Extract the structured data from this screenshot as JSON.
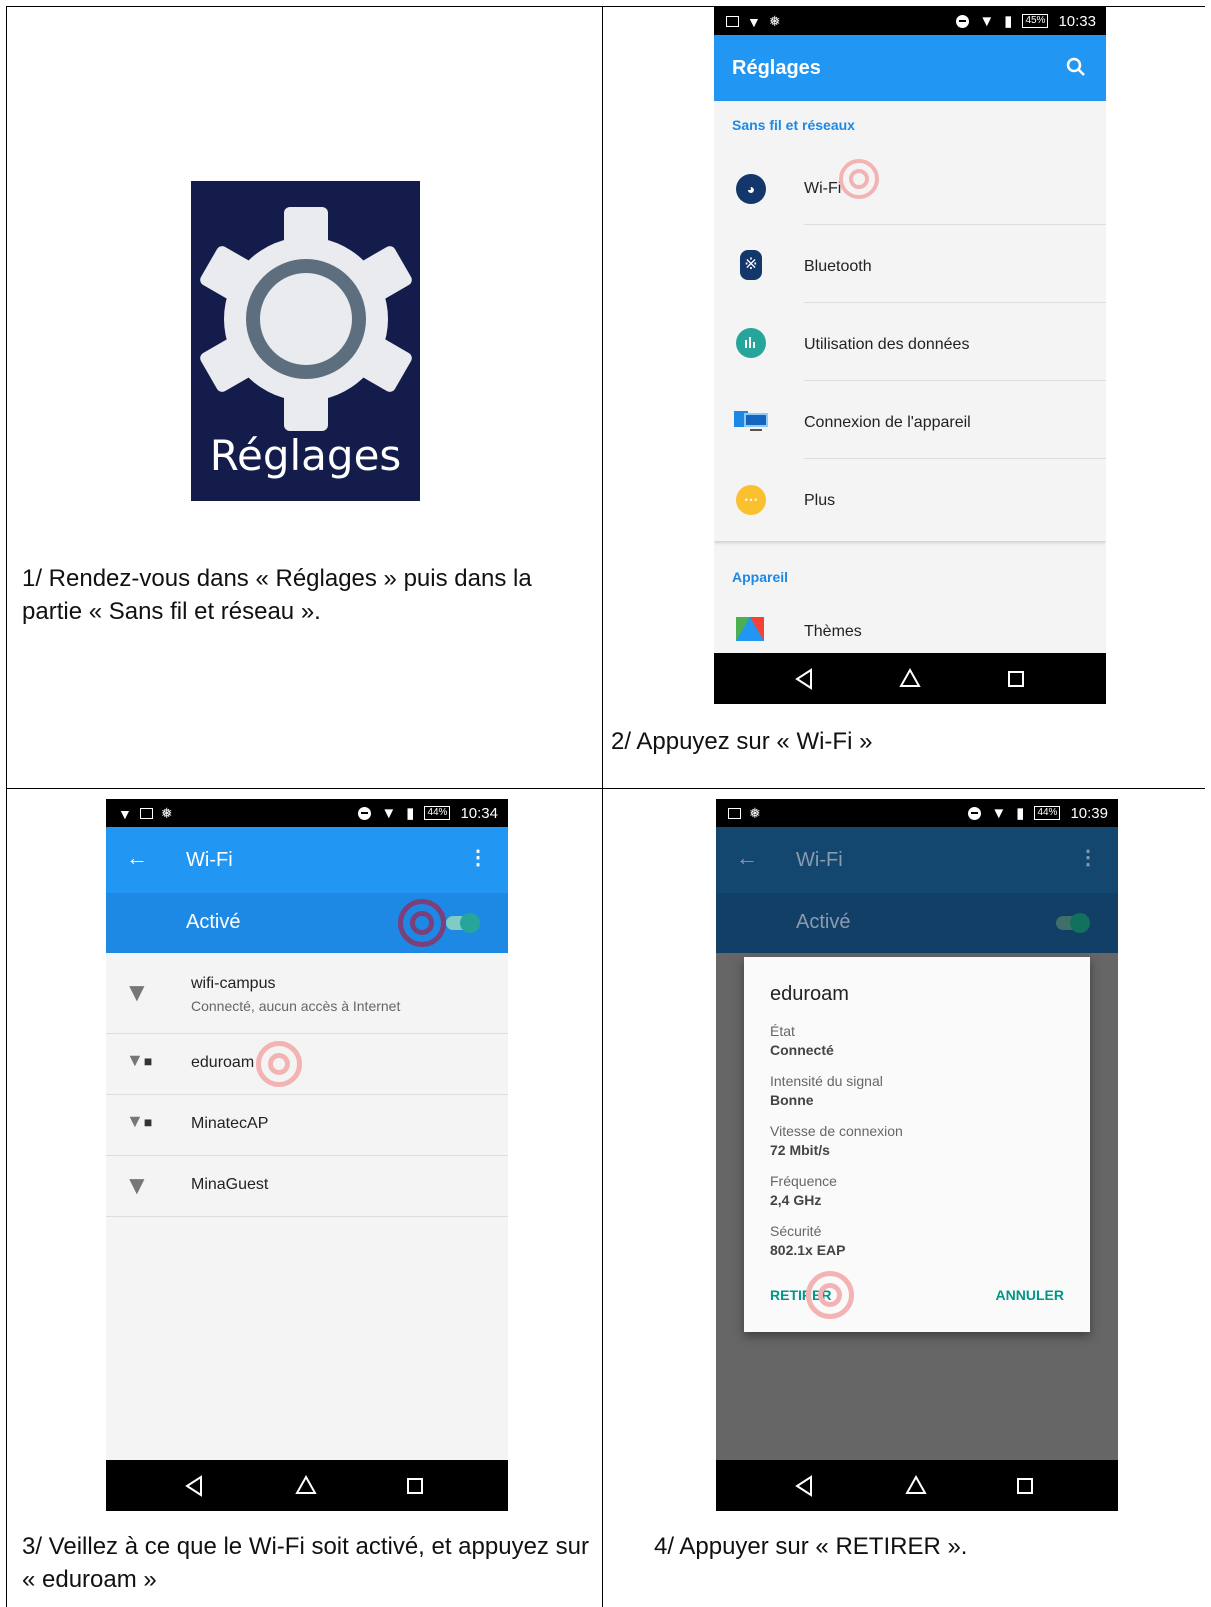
{
  "steps": {
    "step1": {
      "caption": "1/ Rendez-vous dans « Réglages » puis dans la partie « Sans fil et réseau »."
    },
    "step2": {
      "caption": "2/ Appuyez sur « Wi-Fi »"
    },
    "step3": {
      "caption": "3/ Veillez à ce que le Wi-Fi soit activé, et appuyez sur « eduroam »"
    },
    "step4": {
      "caption": "4/ Appuyer sur « RETIRER »."
    }
  },
  "app_icon": {
    "label": "Réglages",
    "icon": "gear-icon",
    "bg": "#141c4c"
  },
  "screen2": {
    "status": {
      "battery": "45%",
      "time": "10:33"
    },
    "title": "Réglages",
    "section1": "Sans fil et réseaux",
    "items": [
      {
        "label": "Wi-Fi",
        "icon": "wifi-icon",
        "color": "#13366b"
      },
      {
        "label": "Bluetooth",
        "icon": "bluetooth-icon",
        "color": "#13366b"
      },
      {
        "label": "Utilisation des données",
        "icon": "data-usage-icon",
        "color": "#26a69a"
      },
      {
        "label": "Connexion de l'appareil",
        "icon": "device-connection-icon",
        "color": "#1e88e5"
      },
      {
        "label": "Plus",
        "icon": "more-icon",
        "color": "#fbc02d"
      }
    ],
    "section2": "Appareil",
    "item_themes": "Thèmes"
  },
  "screen3": {
    "status": {
      "battery": "44%",
      "time": "10:34"
    },
    "title": "Wi-Fi",
    "toggle_label": "Activé",
    "networks": [
      {
        "name": "wifi-campus",
        "sub": "Connecté, aucun accès à Internet",
        "locked": false
      },
      {
        "name": "eduroam",
        "sub": "",
        "locked": true
      },
      {
        "name": "MinatecAP",
        "sub": "",
        "locked": true
      },
      {
        "name": "MinaGuest",
        "sub": "",
        "locked": false
      }
    ]
  },
  "screen4": {
    "status": {
      "battery": "44%",
      "time": "10:39"
    },
    "title": "Wi-Fi",
    "toggle_label": "Activé",
    "dialog": {
      "title": "eduroam",
      "fields": [
        {
          "label": "État",
          "value": "Connecté"
        },
        {
          "label": "Intensité du signal",
          "value": "Bonne"
        },
        {
          "label": "Vitesse de connexion",
          "value": "72 Mbit/s"
        },
        {
          "label": "Fréquence",
          "value": "2,4 GHz"
        },
        {
          "label": "Sécurité",
          "value": "802.1x EAP"
        }
      ],
      "remove_label": "RETIRER",
      "cancel_label": "ANNULER"
    }
  },
  "colors": {
    "accent": "#2196f3",
    "teal": "#009688",
    "target": "#f4b3b3"
  }
}
